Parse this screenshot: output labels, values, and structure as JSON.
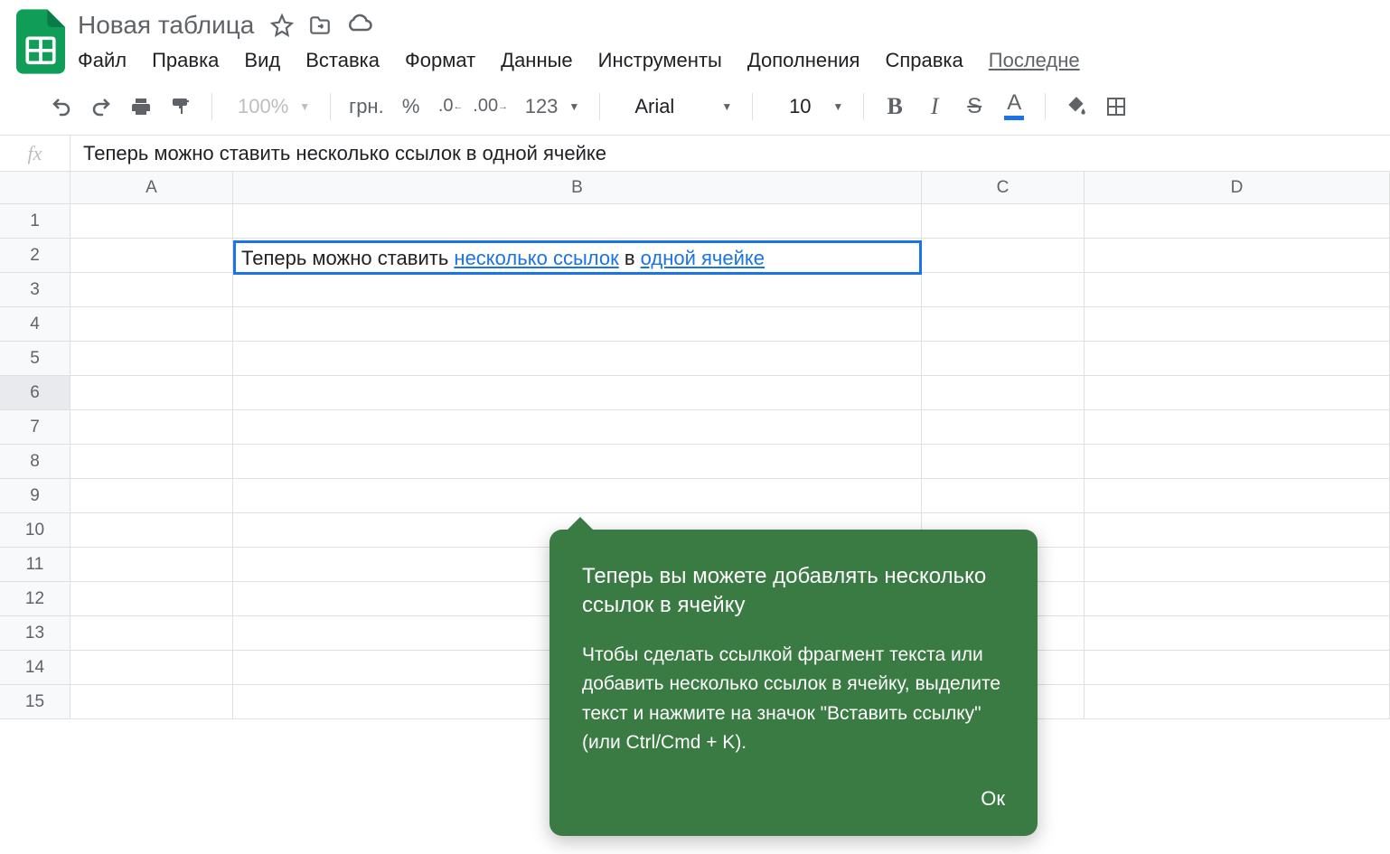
{
  "doc": {
    "title": "Новая таблица"
  },
  "menu": {
    "file": "Файл",
    "edit": "Правка",
    "view": "Вид",
    "insert": "Вставка",
    "format": "Формат",
    "data": "Данные",
    "tools": "Инструменты",
    "addons": "Дополнения",
    "help": "Справка",
    "last_edit": "Последне"
  },
  "toolbar": {
    "zoom": "100%",
    "currency": "грн.",
    "percent": "%",
    "dec_dec": ".0",
    "inc_dec": ".00",
    "num": "123",
    "font": "Arial",
    "size": "10",
    "bold": "B",
    "italic": "I",
    "strike": "S",
    "text_color": "A"
  },
  "formula_bar": {
    "fx": "fx",
    "value": "Теперь можно ставить несколько ссылок в одной ячейке"
  },
  "columns": [
    "A",
    "B",
    "C",
    "D"
  ],
  "rows": [
    "1",
    "2",
    "3",
    "4",
    "5",
    "6",
    "7",
    "8",
    "9",
    "10",
    "11",
    "12",
    "13",
    "14",
    "15"
  ],
  "active_cell": {
    "prefix": "Теперь можно ставить ",
    "link1": "несколько ссылок",
    "mid": " в ",
    "link2": "одной ячейке"
  },
  "tooltip": {
    "title": "Теперь вы можете добавлять несколько ссылок в ячейку",
    "body": "Чтобы сделать ссылкой фрагмент текста или добавить несколько ссылок в ячейку, выделите текст и нажмите на значок \"Вставить ссылку\" (или Ctrl/Cmd + K).",
    "ok": "Ок"
  }
}
